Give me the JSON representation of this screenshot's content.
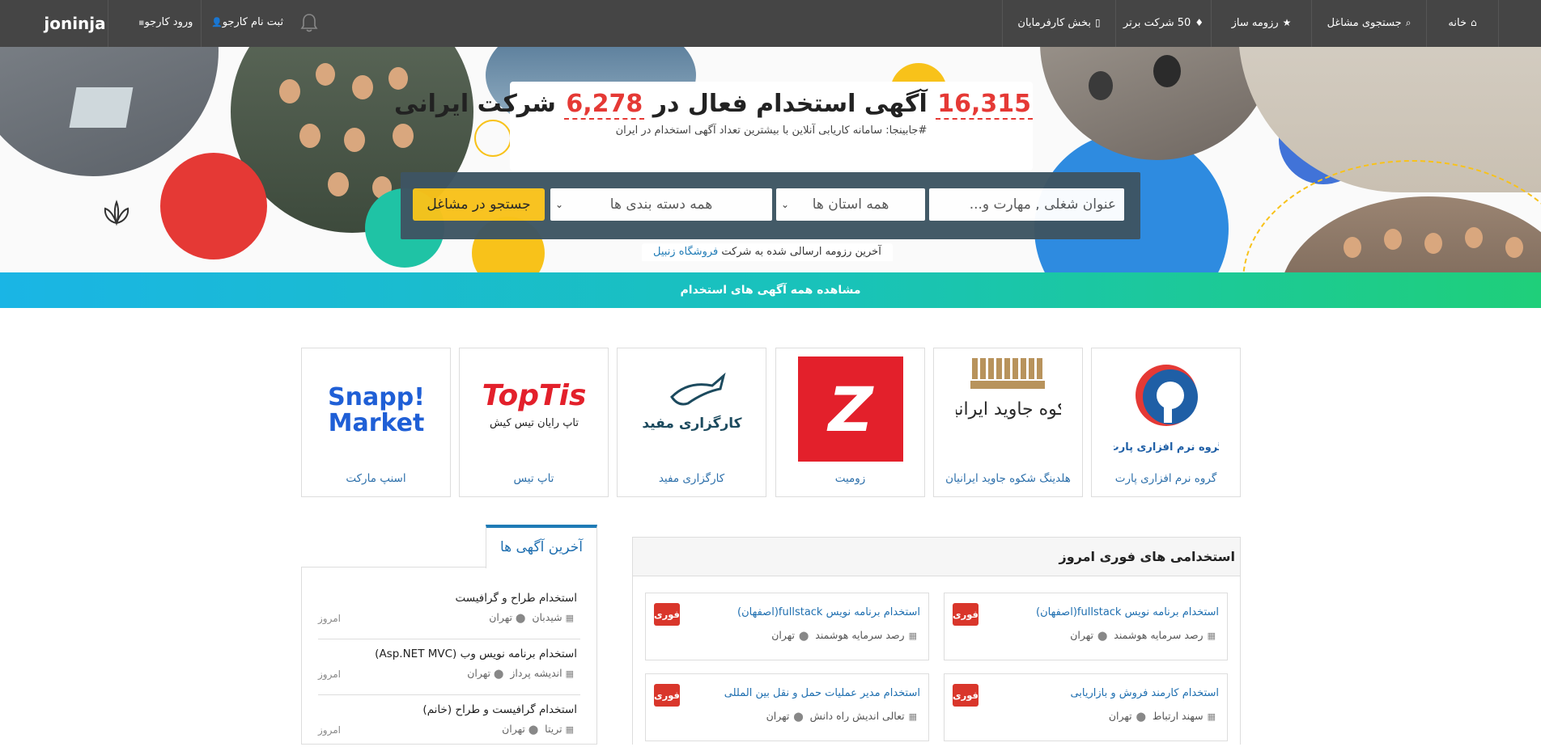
{
  "nav": {
    "brand": "joninja",
    "login": "ورود کارجو",
    "signup": "ثبت نام کارجو",
    "right": [
      {
        "label": "خانه",
        "icon": "home-icon"
      },
      {
        "label": "جستجوی مشاغل",
        "icon": "search-icon"
      },
      {
        "label": "رزومه ساز",
        "icon": "star-icon"
      },
      {
        "label": "50 شرکت برتر",
        "icon": "diamond-icon"
      },
      {
        "label": "بخش کارفرمایان",
        "icon": "building-icon"
      }
    ]
  },
  "hero": {
    "jobs_count": "16,315",
    "mid_text": "آگهی استخدام فعال در",
    "company_count": "6,278",
    "tail_text": "شرکت ایرانی",
    "subtitle": "#جابینجا: سامانه کاریابی آنلاین با بیشترین تعداد آگهی استخدام در ایران",
    "search_placeholder": "عنوان شغلی , مهارت و...",
    "province": "همه استان ها",
    "category": "همه دسته بندی ها",
    "search_button": "جستجو در مشاغل",
    "latest_cv_prefix": "آخرین رزومه ارسالی شده به شرکت",
    "latest_cv_company": "فروشگاه زنبیل",
    "all_jobs": "مشاهده همه آگهی های استخدام"
  },
  "companies": [
    {
      "name": "گروه نرم افزاری پارت",
      "logo_text": "گروه نرم افزاری پارت"
    },
    {
      "name": "هلدینگ شکوه جاوید ایرانیان",
      "logo_text": "شکوه جاوید ایرانیان"
    },
    {
      "name": "زومیت",
      "logo_text": "Z"
    },
    {
      "name": "کارگزاری مفید",
      "logo_text": "کارگزاری مفید"
    },
    {
      "name": "تاپ تیس",
      "logo_text": "TopTis",
      "logo_sub": "تاپ رایان تیس کیش"
    },
    {
      "name": "اسنپ مارکت",
      "logo_text": "Snapp!",
      "logo_sub": "Market"
    }
  ],
  "urgent": {
    "title": "استخدامی های فوری امروز",
    "badge": "فوری",
    "jobs": [
      {
        "title": "استخدام برنامه نویس fullstack(اصفهان)",
        "company": "رصد سرمایه هوشمند",
        "city": "تهران"
      },
      {
        "title": "استخدام برنامه نویس fullstack(اصفهان)",
        "company": "رصد سرمایه هوشمند",
        "city": "تهران"
      },
      {
        "title": "استخدام کارمند فروش و بازاریابی",
        "company": "سهند ارتباط",
        "city": "تهران"
      },
      {
        "title": "استخدام مدیر عملیات حمل و نقل بین المللی",
        "company": "تعالی اندیش راه دانش",
        "city": "تهران"
      }
    ]
  },
  "latest": {
    "tab": "آخرین آگهی ها",
    "items": [
      {
        "title": "استخدام طراح و گرافیست",
        "company": "شیدبان",
        "city": "تهران",
        "date": "امروز"
      },
      {
        "title": "استخدام برنامه نویس وب (Asp.NET MVC)",
        "company": "اندیشه پرداز",
        "city": "تهران",
        "date": "امروز"
      },
      {
        "title": "استخدام گرافیست و طراح (خانم)",
        "company": "تریتا",
        "city": "تهران",
        "date": "امروز"
      }
    ]
  },
  "colors": {
    "accent": "#1f7bb6",
    "nav": "#454545",
    "yellow": "#f8c21a",
    "red": "#e53935",
    "badge": "#d9362b"
  }
}
